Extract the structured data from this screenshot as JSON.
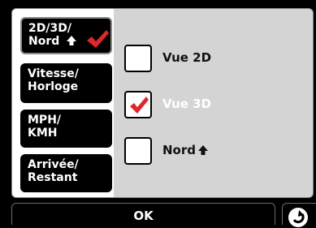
{
  "sidebar": {
    "items": [
      {
        "line1": "2D/3D/",
        "line2": "Nord",
        "arrow_icon": "up-arrow-icon",
        "check_icon": "red-checkmark-icon",
        "selected": true
      },
      {
        "line1": "Vitesse/",
        "line2": "Horloge"
      },
      {
        "line1": "MPH/",
        "line2": "KMH"
      },
      {
        "line1": "Arrivée/",
        "line2": "Restant"
      }
    ]
  },
  "options": [
    {
      "label": "Vue 2D",
      "checked": false
    },
    {
      "label": "Vue 3D",
      "checked": true
    },
    {
      "label": "Nord",
      "checked": false,
      "icon": "up-arrow-icon"
    }
  ],
  "footer": {
    "ok_label": "OK",
    "back_icon": "back-arrow-icon"
  },
  "colors": {
    "check_red": "#e0262d",
    "panel_bg": "#d4d4d4",
    "button_bg": "#000000",
    "button_text": "#ffffff"
  }
}
